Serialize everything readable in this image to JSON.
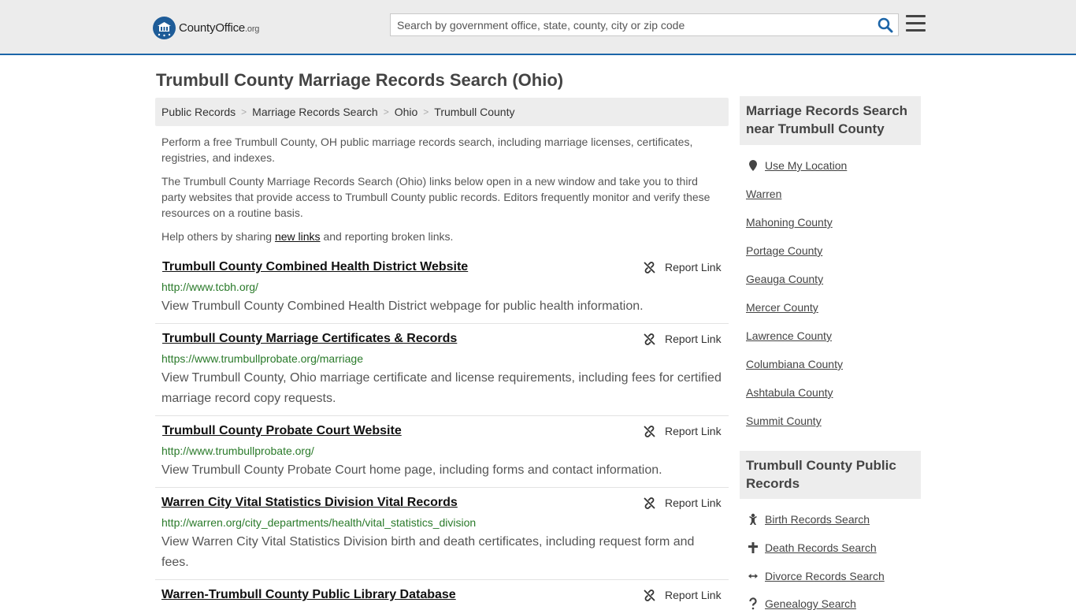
{
  "header": {
    "logo_text": "CountyOffice",
    "logo_suffix": ".org",
    "search_placeholder": "Search by government office, state, county, city or zip code"
  },
  "page": {
    "title": "Trumbull County Marriage Records Search (Ohio)"
  },
  "breadcrumb": [
    "Public Records",
    "Marriage Records Search",
    "Ohio",
    "Trumbull County"
  ],
  "intro": {
    "p1": "Perform a free Trumbull County, OH public marriage records search, including marriage licenses, certificates, registries, and indexes.",
    "p2": "The Trumbull County Marriage Records Search (Ohio) links below open in a new window and take you to third party websites that provide access to Trumbull County public records. Editors frequently monitor and verify these resources on a routine basis.",
    "p3_before": "Help others by sharing ",
    "p3_link": "new links",
    "p3_after": " and reporting broken links."
  },
  "report_label": "Report Link",
  "results": [
    {
      "title": "Trumbull County Combined Health District Website",
      "url": "http://www.tcbh.org/",
      "desc": "View Trumbull County Combined Health District webpage for public health information."
    },
    {
      "title": "Trumbull County Marriage Certificates & Records",
      "url": "https://www.trumbullprobate.org/marriage",
      "desc": "View Trumbull County, Ohio marriage certificate and license requirements, including fees for certified marriage record copy requests."
    },
    {
      "title": "Trumbull County Probate Court Website",
      "url": "http://www.trumbullprobate.org/",
      "desc": "View Trumbull County Probate Court home page, including forms and contact information."
    },
    {
      "title": "Warren City Vital Statistics Division Vital Records",
      "url": "http://warren.org/city_departments/health/vital_statistics_division",
      "desc": "View Warren City Vital Statistics Division birth and death certificates, including request form and fees."
    },
    {
      "title": "Warren-Trumbull County Public Library Database",
      "url": "",
      "desc": ""
    }
  ],
  "sidebar": {
    "nearby_title": "Marriage Records Search near Trumbull County",
    "use_location": "Use My Location",
    "nearby": [
      "Warren",
      "Mahoning County",
      "Portage County",
      "Geauga County",
      "Mercer County",
      "Lawrence County",
      "Columbiana County",
      "Ashtabula County",
      "Summit County"
    ],
    "public_title": "Trumbull County Public Records",
    "public_links": [
      "Birth Records Search",
      "Death Records Search",
      "Divorce Records Search",
      "Genealogy Search"
    ]
  }
}
